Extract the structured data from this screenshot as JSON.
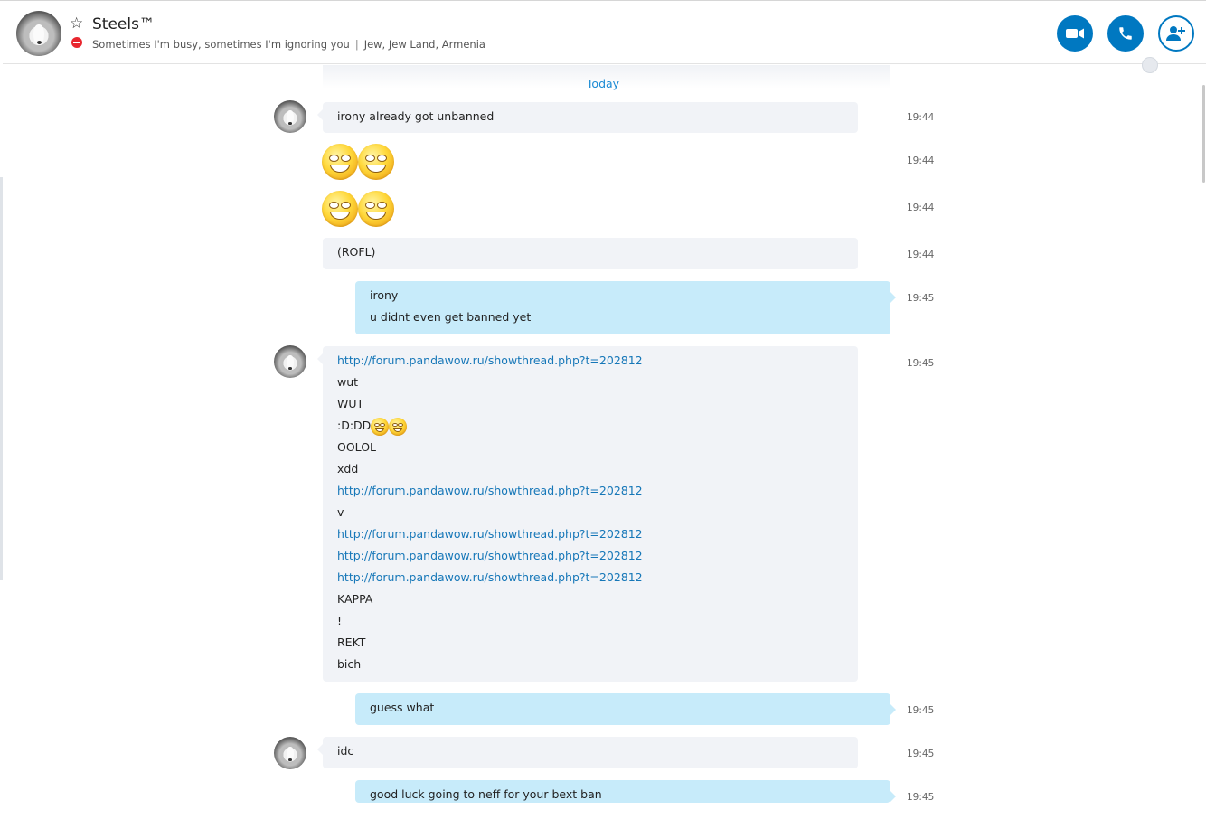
{
  "header": {
    "contact_name": "Steels™",
    "status": "Sometimes I'm busy, sometimes I'm ignoring you",
    "location": "Jew, Jew Land, Armenia"
  },
  "conversation": {
    "date_divider": "Today",
    "messages": [
      {
        "time": "19:44",
        "lines": [
          "irony already got unbanned"
        ]
      },
      {
        "time": "19:44",
        "emoticons": [
          "smile-emoticon",
          "smile-emoticon"
        ]
      },
      {
        "time": "19:44",
        "emoticons": [
          "smile-emoticon",
          "smile-emoticon"
        ]
      },
      {
        "time": "19:44",
        "lines": [
          "(ROFL)"
        ]
      },
      {
        "time": "19:45",
        "lines": [
          "irony",
          "u didnt even get banned yet"
        ]
      },
      {
        "time": "19:45",
        "lines": [
          "http://forum.pandawow.ru/showthread.php?t=202812",
          "wut",
          "WUT",
          ":D:DD",
          "OOLOL",
          "xdd",
          "http://forum.pandawow.ru/showthread.php?t=202812",
          "v",
          "http://forum.pandawow.ru/showthread.php?t=202812",
          "http://forum.pandawow.ru/showthread.php?t=202812",
          "http://forum.pandawow.ru/showthread.php?t=202812",
          "KAPPA",
          "!",
          "REKT",
          "bich"
        ]
      },
      {
        "time": "19:45",
        "lines": [
          "guess what"
        ]
      },
      {
        "time": "19:45",
        "lines": [
          "idc"
        ]
      },
      {
        "time": "19:45",
        "lines": [
          "good luck going to neff for your bext ban"
        ]
      }
    ]
  },
  "colors": {
    "accent": "#0078c1",
    "incoming_bubble": "#f1f3f7",
    "outgoing_bubble": "#c7ebfa",
    "link": "#1677b8",
    "busy_status": "#e8262e"
  }
}
